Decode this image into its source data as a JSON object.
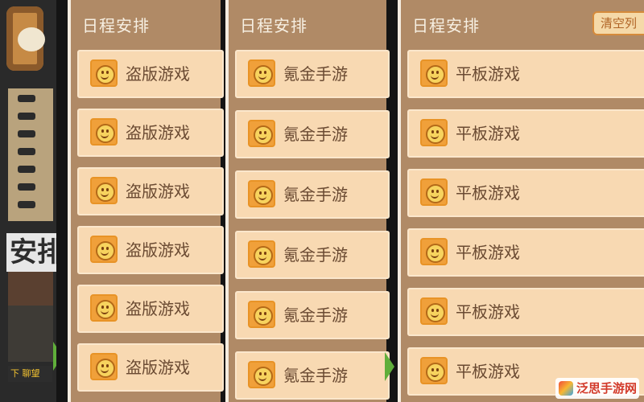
{
  "left_strip": {
    "sign_text": "安排",
    "badge_text": "下 聊望"
  },
  "panels": [
    {
      "title": "日程安排",
      "items": [
        "盗版游戏",
        "盗版游戏",
        "盗版游戏",
        "盗版游戏",
        "盗版游戏",
        "盗版游戏"
      ]
    },
    {
      "title": "日程安排",
      "items": [
        "氪金手游",
        "氪金手游",
        "氪金手游",
        "氪金手游",
        "氪金手游",
        "氪金手游"
      ]
    },
    {
      "title": "日程安排",
      "clear_label": "清空列",
      "items": [
        "平板游戏",
        "平板游戏",
        "平板游戏",
        "平板游戏",
        "平板游戏",
        "平板游戏"
      ]
    }
  ],
  "icons": {
    "entry_icon": "smiley-face-icon",
    "arrow_icon": "green-arrow-icon"
  },
  "colors": {
    "panel_bg": "#b08a66",
    "entry_bg": "#f8d9b2",
    "icon_bg": "#f0a03a",
    "title_text": "#f7f0e3",
    "label_text": "#6a4a32"
  },
  "watermark": {
    "text": "泛思手游网"
  }
}
